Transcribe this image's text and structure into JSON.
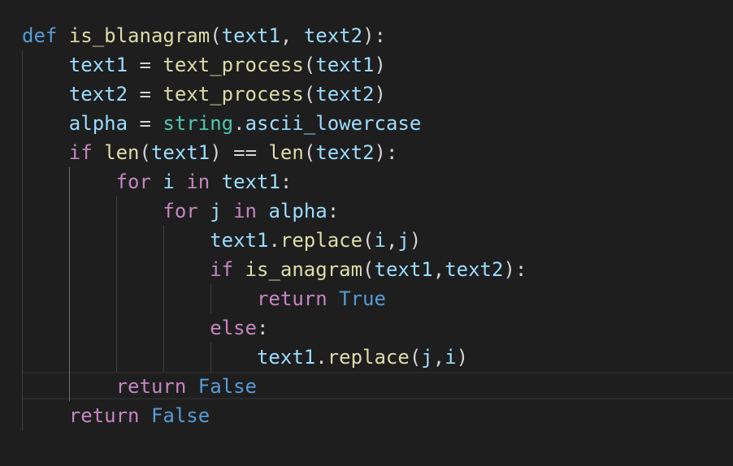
{
  "editor": {
    "lines": [
      [
        {
          "t": "def",
          "c": "kw-storage"
        },
        {
          "t": " ",
          "c": "punc"
        },
        {
          "t": "is_blanagram",
          "c": "fn"
        },
        {
          "t": "(",
          "c": "punc"
        },
        {
          "t": "text1",
          "c": "var"
        },
        {
          "t": ", ",
          "c": "punc"
        },
        {
          "t": "text2",
          "c": "var"
        },
        {
          "t": "):",
          "c": "punc"
        }
      ],
      [
        {
          "t": "    ",
          "c": "punc"
        },
        {
          "t": "text1",
          "c": "var"
        },
        {
          "t": " = ",
          "c": "op"
        },
        {
          "t": "text_process",
          "c": "fn"
        },
        {
          "t": "(",
          "c": "punc"
        },
        {
          "t": "text1",
          "c": "var"
        },
        {
          "t": ")",
          "c": "punc"
        }
      ],
      [
        {
          "t": "    ",
          "c": "punc"
        },
        {
          "t": "text2",
          "c": "var"
        },
        {
          "t": " = ",
          "c": "op"
        },
        {
          "t": "text_process",
          "c": "fn"
        },
        {
          "t": "(",
          "c": "punc"
        },
        {
          "t": "text2",
          "c": "var"
        },
        {
          "t": ")",
          "c": "punc"
        }
      ],
      [
        {
          "t": "    ",
          "c": "punc"
        },
        {
          "t": "alpha",
          "c": "var"
        },
        {
          "t": " = ",
          "c": "op"
        },
        {
          "t": "string",
          "c": "cls"
        },
        {
          "t": ".",
          "c": "punc"
        },
        {
          "t": "ascii_lowercase",
          "c": "var"
        }
      ],
      [
        {
          "t": "    ",
          "c": "punc"
        },
        {
          "t": "if",
          "c": "kw-control"
        },
        {
          "t": " ",
          "c": "punc"
        },
        {
          "t": "len",
          "c": "fn"
        },
        {
          "t": "(",
          "c": "punc"
        },
        {
          "t": "text1",
          "c": "var"
        },
        {
          "t": ") == ",
          "c": "op"
        },
        {
          "t": "len",
          "c": "fn"
        },
        {
          "t": "(",
          "c": "punc"
        },
        {
          "t": "text2",
          "c": "var"
        },
        {
          "t": "):",
          "c": "punc"
        }
      ],
      [
        {
          "t": "        ",
          "c": "punc"
        },
        {
          "t": "for",
          "c": "kw-control"
        },
        {
          "t": " ",
          "c": "punc"
        },
        {
          "t": "i",
          "c": "var"
        },
        {
          "t": " ",
          "c": "punc"
        },
        {
          "t": "in",
          "c": "kw-control"
        },
        {
          "t": " ",
          "c": "punc"
        },
        {
          "t": "text1",
          "c": "var"
        },
        {
          "t": ":",
          "c": "punc"
        }
      ],
      [
        {
          "t": "            ",
          "c": "punc"
        },
        {
          "t": "for",
          "c": "kw-control"
        },
        {
          "t": " ",
          "c": "punc"
        },
        {
          "t": "j",
          "c": "var"
        },
        {
          "t": " ",
          "c": "punc"
        },
        {
          "t": "in",
          "c": "kw-control"
        },
        {
          "t": " ",
          "c": "punc"
        },
        {
          "t": "alpha",
          "c": "var"
        },
        {
          "t": ":",
          "c": "punc"
        }
      ],
      [
        {
          "t": "                ",
          "c": "punc"
        },
        {
          "t": "text1",
          "c": "var"
        },
        {
          "t": ".",
          "c": "punc"
        },
        {
          "t": "replace",
          "c": "fn"
        },
        {
          "t": "(",
          "c": "punc"
        },
        {
          "t": "i",
          "c": "var"
        },
        {
          "t": ",",
          "c": "punc"
        },
        {
          "t": "j",
          "c": "var"
        },
        {
          "t": ")",
          "c": "punc"
        }
      ],
      [
        {
          "t": "                ",
          "c": "punc"
        },
        {
          "t": "if",
          "c": "kw-control"
        },
        {
          "t": " ",
          "c": "punc"
        },
        {
          "t": "is_anagram",
          "c": "fn"
        },
        {
          "t": "(",
          "c": "punc"
        },
        {
          "t": "text1",
          "c": "var"
        },
        {
          "t": ",",
          "c": "punc"
        },
        {
          "t": "text2",
          "c": "var"
        },
        {
          "t": "):",
          "c": "punc"
        }
      ],
      [
        {
          "t": "                    ",
          "c": "punc"
        },
        {
          "t": "return",
          "c": "kw-control"
        },
        {
          "t": " ",
          "c": "punc"
        },
        {
          "t": "True",
          "c": "const"
        }
      ],
      [
        {
          "t": "                ",
          "c": "punc"
        },
        {
          "t": "else",
          "c": "kw-control"
        },
        {
          "t": ":",
          "c": "punc"
        }
      ],
      [
        {
          "t": "                    ",
          "c": "punc"
        },
        {
          "t": "text1",
          "c": "var"
        },
        {
          "t": ".",
          "c": "punc"
        },
        {
          "t": "replace",
          "c": "fn"
        },
        {
          "t": "(",
          "c": "punc"
        },
        {
          "t": "j",
          "c": "var"
        },
        {
          "t": ",",
          "c": "punc"
        },
        {
          "t": "i",
          "c": "var"
        },
        {
          "t": ")",
          "c": "punc"
        }
      ],
      [
        {
          "t": "        ",
          "c": "punc"
        },
        {
          "t": "return",
          "c": "kw-control"
        },
        {
          "t": " ",
          "c": "punc"
        },
        {
          "t": "False",
          "c": "const"
        }
      ],
      [
        {
          "t": "    ",
          "c": "punc"
        },
        {
          "t": "return",
          "c": "kw-control"
        },
        {
          "t": " ",
          "c": "punc"
        },
        {
          "t": "False",
          "c": "const"
        }
      ]
    ]
  }
}
